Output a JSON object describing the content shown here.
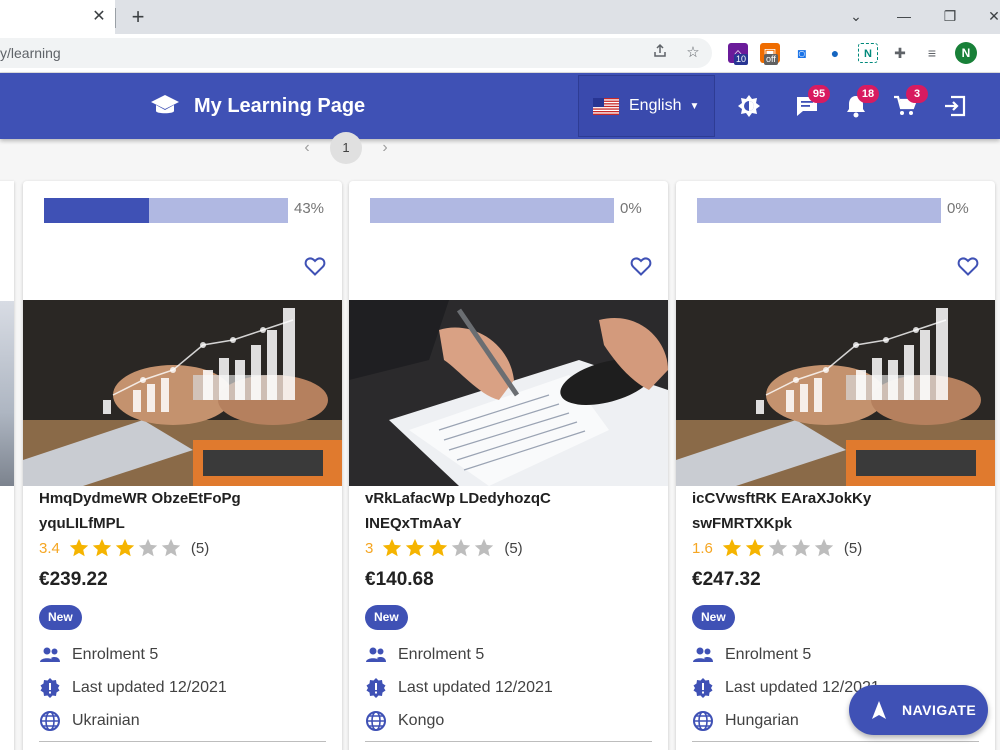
{
  "browser": {
    "tab_close": "✕",
    "new_tab": "+",
    "url": "y/learning",
    "window_controls": {
      "chevron": "⌄",
      "minimize": "—",
      "restore": "❐",
      "close": "✕"
    },
    "extensions": [
      {
        "name": "home-ext-icon",
        "badge": "10",
        "color": "#6a1b9a"
      },
      {
        "name": "dev-ext-icon",
        "badge": "off",
        "color": "#ef6c00"
      },
      {
        "name": "record-ext-icon",
        "badge": "",
        "color": "#1a73e8"
      },
      {
        "name": "color-ext-icon",
        "badge": "",
        "color": "#1565c0"
      },
      {
        "name": "n-ext-icon",
        "badge": "",
        "color": "#00897b"
      },
      {
        "name": "puzzle-icon",
        "badge": "",
        "color": "#5f6368"
      },
      {
        "name": "media-icon",
        "badge": "",
        "color": "#5f6368"
      }
    ],
    "profile_initial": "N"
  },
  "header": {
    "title": "My Learning Page",
    "language": "English",
    "messages_count": "95",
    "notifications_count": "18",
    "cart_count": "3"
  },
  "pagination": {
    "current": "1",
    "prev": "‹",
    "next": "›"
  },
  "courses": [
    {
      "progress_label": "43%",
      "progress_fraction": 0.43,
      "title_line1": "HmqDydmeWR ObzeEtFoPg",
      "title_line2": "yquLILfMPL",
      "rating": "3.4",
      "stars_filled": 3,
      "reviews": "(5)",
      "price": "€239.22",
      "badge": "New",
      "enrolment": "Enrolment 5",
      "updated": "Last updated 12/2021",
      "language": "Ukrainian",
      "image": "finance-chart"
    },
    {
      "progress_label": "0%",
      "progress_fraction": 0,
      "title_line1": "vRkLafacWp LDedyhozqC",
      "title_line2": "INEQxTmAaY",
      "rating": "3",
      "stars_filled": 3,
      "reviews": "(5)",
      "price": "€140.68",
      "badge": "New",
      "enrolment": "Enrolment 5",
      "updated": "Last updated 12/2021",
      "language": "Kongo",
      "image": "writing-document"
    },
    {
      "progress_label": "0%",
      "progress_fraction": 0,
      "title_line1": "icCVwsftRK EAraXJokKy",
      "title_line2": "swFMRTXKpk",
      "rating": "1.6",
      "stars_filled": 2,
      "reviews": "(5)",
      "price": "€247.32",
      "badge": "New",
      "enrolment": "Enrolment 5",
      "updated": "Last updated 12/2021",
      "language": "Hungarian",
      "image": "finance-chart"
    }
  ],
  "fab": {
    "label": "NAVIGATE"
  },
  "colors": {
    "primary": "#3f51b5",
    "progress_track": "#b0b8e2",
    "star": "#f5b400",
    "star_empty": "#bdbdbd",
    "badge": "#d81b60",
    "rating_text": "#f5a623"
  }
}
